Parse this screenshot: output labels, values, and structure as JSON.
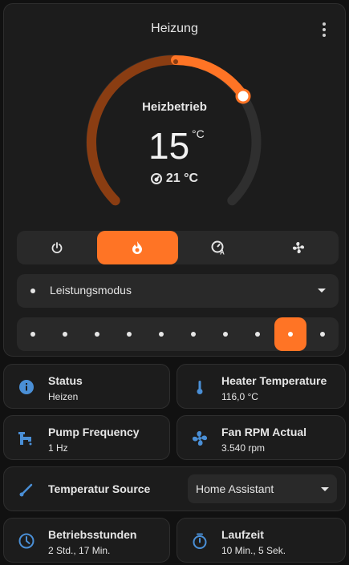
{
  "main": {
    "title": "Heizung",
    "mode_label": "Heizbetrieb",
    "target_temp": "15",
    "target_unit": "°C",
    "current_temp": "21 °C",
    "modes": [
      "off",
      "heat",
      "auto",
      "fan"
    ],
    "active_mode": "heat",
    "preset_select": "Leistungsmodus",
    "levels_count": 10,
    "active_level": 9
  },
  "tiles": {
    "status": {
      "name": "Status",
      "value": "Heizen"
    },
    "heater_temp": {
      "name": "Heater Temperature",
      "value": "116,0 °C"
    },
    "pump": {
      "name": "Pump Frequency",
      "value": "1 Hz"
    },
    "fan": {
      "name": "Fan RPM Actual",
      "value": "3.540 rpm"
    },
    "temp_source": {
      "name": "Temperatur Source",
      "value": "Home Assistant"
    },
    "hours": {
      "name": "Betriebsstunden",
      "value": "2 Std., 17 Min."
    },
    "runtime": {
      "name": "Laufzeit",
      "value": "10 Min., 5 Sek."
    }
  },
  "colors": {
    "accent": "#ff7425",
    "accent_dim": "#8a3d12",
    "track": "#2f2f2f",
    "icon_blue": "#4a8fd6"
  },
  "icons": [
    "more-vert-icon",
    "power-icon",
    "fire-icon",
    "auto-mode-icon",
    "fan-icon",
    "info-icon",
    "thermometer-icon",
    "pump-icon",
    "fan-icon",
    "pen-icon",
    "clock-icon",
    "timer-icon"
  ]
}
